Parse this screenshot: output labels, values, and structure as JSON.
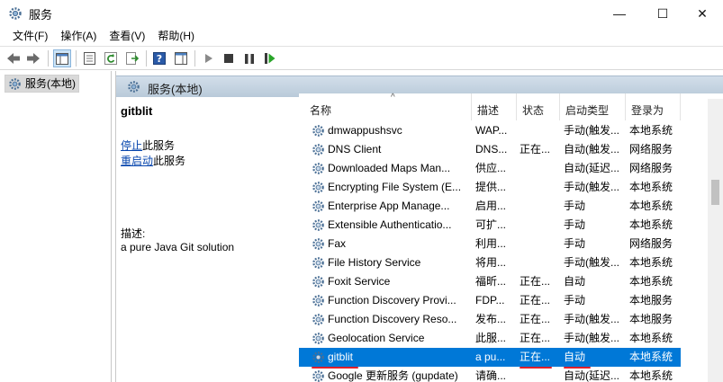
{
  "window": {
    "title": "服务",
    "min_glyph": "—",
    "max_glyph": "☐",
    "close_glyph": "✕"
  },
  "menu": [
    "文件(F)",
    "操作(A)",
    "查看(V)",
    "帮助(H)"
  ],
  "tree": {
    "item_label": "服务(本地)"
  },
  "pane_header": {
    "title": "服务(本地)"
  },
  "details": {
    "service_name": "gitblit",
    "stop_link": "停止",
    "stop_suffix": "此服务",
    "restart_link": "重启动",
    "restart_suffix": "此服务",
    "description_label": "描述:",
    "description_text": "a pure Java Git solution"
  },
  "columns": {
    "name": "名称",
    "description": "描述",
    "status": "状态",
    "startup_type": "启动类型",
    "logon_as": "登录为"
  },
  "rows": [
    {
      "name": "dmwappushsvc",
      "description": "WAP...",
      "status": "",
      "startup": "手动(触发...",
      "logon": "本地系统"
    },
    {
      "name": "DNS Client",
      "description": "DNS...",
      "status": "正在...",
      "startup": "自动(触发...",
      "logon": "网络服务"
    },
    {
      "name": "Downloaded Maps Man...",
      "description": "供应...",
      "status": "",
      "startup": "自动(延迟...",
      "logon": "网络服务"
    },
    {
      "name": "Encrypting File System (E...",
      "description": "提供...",
      "status": "",
      "startup": "手动(触发...",
      "logon": "本地系统"
    },
    {
      "name": "Enterprise App Manage...",
      "description": "启用...",
      "status": "",
      "startup": "手动",
      "logon": "本地系统"
    },
    {
      "name": "Extensible Authenticatio...",
      "description": "可扩...",
      "status": "",
      "startup": "手动",
      "logon": "本地系统"
    },
    {
      "name": "Fax",
      "description": "利用...",
      "status": "",
      "startup": "手动",
      "logon": "网络服务"
    },
    {
      "name": "File History Service",
      "description": "将用...",
      "status": "",
      "startup": "手动(触发...",
      "logon": "本地系统"
    },
    {
      "name": "Foxit Service",
      "description": "福昕...",
      "status": "正在...",
      "startup": "自动",
      "logon": "本地系统"
    },
    {
      "name": "Function Discovery Provi...",
      "description": "FDP...",
      "status": "正在...",
      "startup": "手动",
      "logon": "本地服务"
    },
    {
      "name": "Function Discovery Reso...",
      "description": "发布...",
      "status": "正在...",
      "startup": "手动(触发...",
      "logon": "本地服务"
    },
    {
      "name": "Geolocation Service",
      "description": "此服...",
      "status": "正在...",
      "startup": "手动(触发...",
      "logon": "本地系统"
    },
    {
      "name": "gitblit",
      "description": "a pu...",
      "status": "正在...",
      "startup": "自动",
      "logon": "本地系统",
      "selected": true
    },
    {
      "name": "Google 更新服务 (gupdate)",
      "description": "请确...",
      "status": "",
      "startup": "自动(延迟...",
      "logon": "本地系统"
    }
  ],
  "colors": {
    "selection": "#0078d7",
    "link": "#0645ad",
    "annotation_red": "#e0202b",
    "header_blue": "#b9cad9"
  }
}
